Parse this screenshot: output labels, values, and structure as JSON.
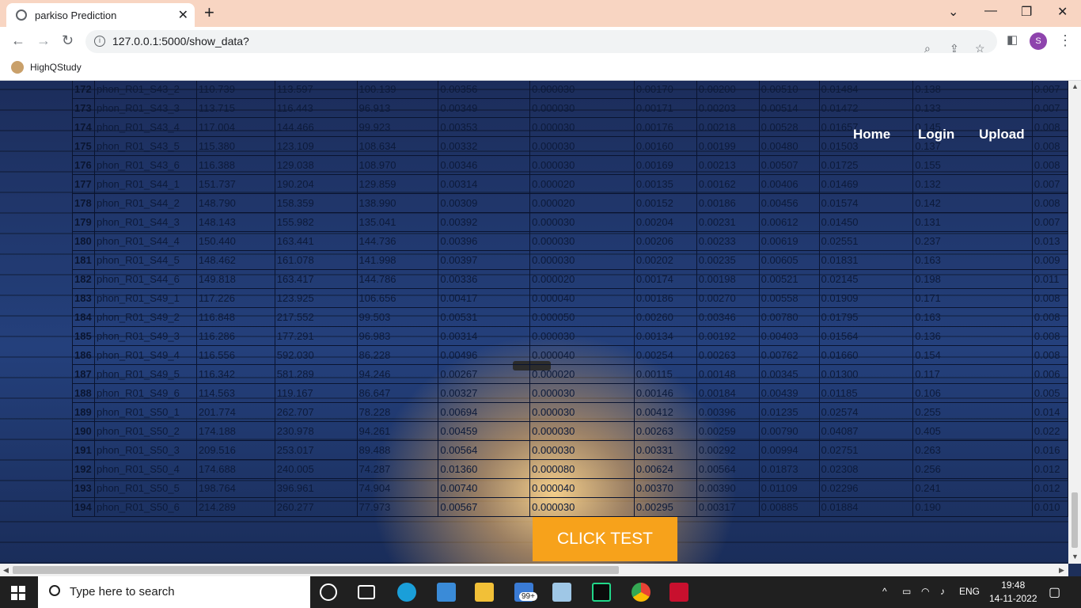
{
  "browser": {
    "tab_title": "parkiso Prediction",
    "url": "127.0.0.1:5000/show_data?",
    "avatar_letter": "S",
    "bookmark": "HighQStudy"
  },
  "nav": {
    "home": "Home",
    "login": "Login",
    "upload": "Upload"
  },
  "table": {
    "rows": [
      [
        "172",
        "phon_R01_S43_2",
        "110.739",
        "113.597",
        "100.139",
        "0.00356",
        "0.000030",
        "0.00170",
        "0.00200",
        "0.00510",
        "0.01484",
        "0.138",
        "0.007"
      ],
      [
        "173",
        "phon_R01_S43_3",
        "113.715",
        "116.443",
        "96.913",
        "0.00349",
        "0.000030",
        "0.00171",
        "0.00203",
        "0.00514",
        "0.01472",
        "0.133",
        "0.007"
      ],
      [
        "174",
        "phon_R01_S43_4",
        "117.004",
        "144.466",
        "99.923",
        "0.00353",
        "0.000030",
        "0.00176",
        "0.00218",
        "0.00528",
        "0.01657",
        "0.145",
        "0.008"
      ],
      [
        "175",
        "phon_R01_S43_5",
        "115.380",
        "123.109",
        "108.634",
        "0.00332",
        "0.000030",
        "0.00160",
        "0.00199",
        "0.00480",
        "0.01503",
        "0.137",
        "0.008"
      ],
      [
        "176",
        "phon_R01_S43_6",
        "116.388",
        "129.038",
        "108.970",
        "0.00346",
        "0.000030",
        "0.00169",
        "0.00213",
        "0.00507",
        "0.01725",
        "0.155",
        "0.008"
      ],
      [
        "177",
        "phon_R01_S44_1",
        "151.737",
        "190.204",
        "129.859",
        "0.00314",
        "0.000020",
        "0.00135",
        "0.00162",
        "0.00406",
        "0.01469",
        "0.132",
        "0.007"
      ],
      [
        "178",
        "phon_R01_S44_2",
        "148.790",
        "158.359",
        "138.990",
        "0.00309",
        "0.000020",
        "0.00152",
        "0.00186",
        "0.00456",
        "0.01574",
        "0.142",
        "0.008"
      ],
      [
        "179",
        "phon_R01_S44_3",
        "148.143",
        "155.982",
        "135.041",
        "0.00392",
        "0.000030",
        "0.00204",
        "0.00231",
        "0.00612",
        "0.01450",
        "0.131",
        "0.007"
      ],
      [
        "180",
        "phon_R01_S44_4",
        "150.440",
        "163.441",
        "144.736",
        "0.00396",
        "0.000030",
        "0.00206",
        "0.00233",
        "0.00619",
        "0.02551",
        "0.237",
        "0.013"
      ],
      [
        "181",
        "phon_R01_S44_5",
        "148.462",
        "161.078",
        "141.998",
        "0.00397",
        "0.000030",
        "0.00202",
        "0.00235",
        "0.00605",
        "0.01831",
        "0.163",
        "0.009"
      ],
      [
        "182",
        "phon_R01_S44_6",
        "149.818",
        "163.417",
        "144.786",
        "0.00336",
        "0.000020",
        "0.00174",
        "0.00198",
        "0.00521",
        "0.02145",
        "0.198",
        "0.011"
      ],
      [
        "183",
        "phon_R01_S49_1",
        "117.226",
        "123.925",
        "106.656",
        "0.00417",
        "0.000040",
        "0.00186",
        "0.00270",
        "0.00558",
        "0.01909",
        "0.171",
        "0.008"
      ],
      [
        "184",
        "phon_R01_S49_2",
        "116.848",
        "217.552",
        "99.503",
        "0.00531",
        "0.000050",
        "0.00260",
        "0.00346",
        "0.00780",
        "0.01795",
        "0.163",
        "0.008"
      ],
      [
        "185",
        "phon_R01_S49_3",
        "116.286",
        "177.291",
        "96.983",
        "0.00314",
        "0.000030",
        "0.00134",
        "0.00192",
        "0.00403",
        "0.01564",
        "0.136",
        "0.008"
      ],
      [
        "186",
        "phon_R01_S49_4",
        "116.556",
        "592.030",
        "86.228",
        "0.00496",
        "0.000040",
        "0.00254",
        "0.00263",
        "0.00762",
        "0.01660",
        "0.154",
        "0.008"
      ],
      [
        "187",
        "phon_R01_S49_5",
        "116.342",
        "581.289",
        "94.246",
        "0.00267",
        "0.000020",
        "0.00115",
        "0.00148",
        "0.00345",
        "0.01300",
        "0.117",
        "0.006"
      ],
      [
        "188",
        "phon_R01_S49_6",
        "114.563",
        "119.167",
        "86.647",
        "0.00327",
        "0.000030",
        "0.00146",
        "0.00184",
        "0.00439",
        "0.01185",
        "0.106",
        "0.005"
      ],
      [
        "189",
        "phon_R01_S50_1",
        "201.774",
        "262.707",
        "78.228",
        "0.00694",
        "0.000030",
        "0.00412",
        "0.00396",
        "0.01235",
        "0.02574",
        "0.255",
        "0.014"
      ],
      [
        "190",
        "phon_R01_S50_2",
        "174.188",
        "230.978",
        "94.261",
        "0.00459",
        "0.000030",
        "0.00263",
        "0.00259",
        "0.00790",
        "0.04087",
        "0.405",
        "0.022"
      ],
      [
        "191",
        "phon_R01_S50_3",
        "209.516",
        "253.017",
        "89.488",
        "0.00564",
        "0.000030",
        "0.00331",
        "0.00292",
        "0.00994",
        "0.02751",
        "0.263",
        "0.016"
      ],
      [
        "192",
        "phon_R01_S50_4",
        "174.688",
        "240.005",
        "74.287",
        "0.01360",
        "0.000080",
        "0.00624",
        "0.00564",
        "0.01873",
        "0.02308",
        "0.256",
        "0.012"
      ],
      [
        "193",
        "phon_R01_S50_5",
        "198.764",
        "396.961",
        "74.904",
        "0.00740",
        "0.000040",
        "0.00370",
        "0.00390",
        "0.01109",
        "0.02296",
        "0.241",
        "0.012"
      ],
      [
        "194",
        "phon_R01_S50_6",
        "214.289",
        "260.277",
        "77.973",
        "0.00567",
        "0.000030",
        "0.00295",
        "0.00317",
        "0.00885",
        "0.01884",
        "0.190",
        "0.010"
      ]
    ]
  },
  "button": {
    "click_test": "CLICK TEST"
  },
  "taskbar": {
    "search_placeholder": "Type here to search",
    "notification_badge": "99+",
    "language": "ENG",
    "time": "19:48",
    "date": "14-11-2022"
  }
}
